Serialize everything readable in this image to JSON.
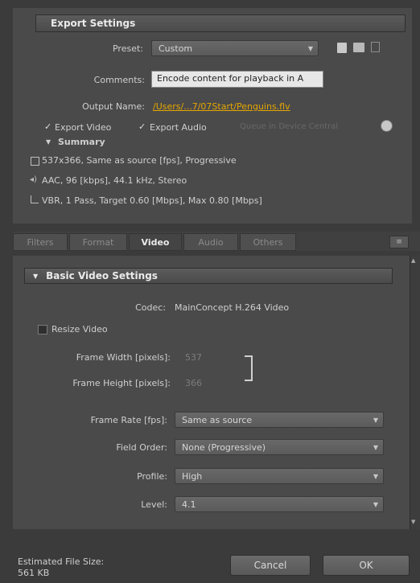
{
  "export_settings": {
    "title": "Export Settings",
    "preset_label": "Preset:",
    "preset_value": "Custom",
    "comments_label": "Comments:",
    "comments_value": "Encode content for playback in A",
    "output_label": "Output Name:",
    "output_value": "/Users/...7/07Start/Penguins.flv",
    "export_video": {
      "label": "Export Video",
      "checked": true
    },
    "export_audio": {
      "label": "Export Audio",
      "checked": true
    },
    "queue_label": "Queue in Device Central",
    "summary_label": "Summary",
    "summary_lines": [
      "537x366, Same as source [fps], Progressive",
      "AAC, 96 [kbps], 44.1 kHz, Stereo",
      "VBR, 1 Pass, Target 0.60 [Mbps], Max 0.80 [Mbps]"
    ]
  },
  "tabs": [
    {
      "label": "Filters",
      "active": false
    },
    {
      "label": "Format",
      "active": false
    },
    {
      "label": "Video",
      "active": true
    },
    {
      "label": "Audio",
      "active": false
    },
    {
      "label": "Others",
      "active": false
    }
  ],
  "basic_video": {
    "title": "Basic Video Settings",
    "codec_label": "Codec:",
    "codec_value": "MainConcept H.264 Video",
    "resize_label": "Resize Video",
    "frame_width_label": "Frame Width [pixels]:",
    "frame_width_value": "537",
    "frame_height_label": "Frame Height [pixels]:",
    "frame_height_value": "366",
    "frame_rate_label": "Frame Rate [fps]:",
    "frame_rate_value": "Same as source",
    "field_order_label": "Field Order:",
    "field_order_value": "None (Progressive)",
    "profile_label": "Profile:",
    "profile_value": "High",
    "level_label": "Level:",
    "level_value": "4.1"
  },
  "footer": {
    "estimated_label": "Estimated File Size:",
    "estimated_value": "561 KB",
    "cancel": "Cancel",
    "ok": "OK"
  }
}
